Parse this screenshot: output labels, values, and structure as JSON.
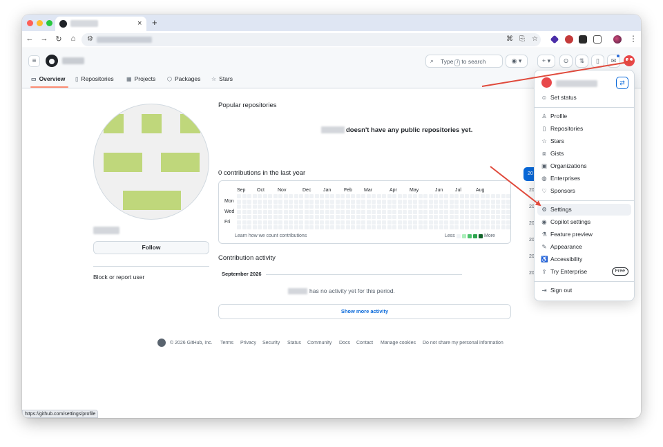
{
  "browser": {
    "new_tab": "+",
    "tab_close": "×",
    "status_url": "https://github.com/settings/profile"
  },
  "header": {
    "search_prefix": "Type",
    "search_slash": "/",
    "search_suffix": "to search",
    "plus_label": "+ ▾"
  },
  "nav": {
    "items": [
      {
        "label": "Overview",
        "icon": "book-icon"
      },
      {
        "label": "Repositories",
        "icon": "repo-icon"
      },
      {
        "label": "Projects",
        "icon": "table-icon"
      },
      {
        "label": "Packages",
        "icon": "package-icon"
      },
      {
        "label": "Stars",
        "icon": "star-icon"
      }
    ]
  },
  "profile": {
    "follow_label": "Follow",
    "block_label": "Block or report user"
  },
  "main": {
    "popular_title": "Popular repositories",
    "no_repos": "doesn't have any public repositories yet.",
    "contrib_title": "0 contributions in the last year",
    "months": [
      "Sep",
      "Oct",
      "Nov",
      "Dec",
      "Jan",
      "Feb",
      "Mar",
      "Apr",
      "May",
      "Jun",
      "Jul",
      "Aug"
    ],
    "days": [
      "Mon",
      "Wed",
      "Fri"
    ],
    "learn_link": "Learn how we count contributions",
    "less": "Less",
    "more": "More",
    "activity_title": "Contribution activity",
    "month_header": "September 2026",
    "no_activity": "has no activity yet for this period.",
    "show_more": "Show more activity",
    "legend_colors": [
      "#eff2f5",
      "#aceebb",
      "#4ac26b",
      "#2da44e",
      "#116329"
    ]
  },
  "year_tabs": {
    "active": "20",
    "others": [
      "20",
      "20",
      "20",
      "20",
      "20",
      "20"
    ]
  },
  "footer": {
    "copyright": "© 2026 GitHub, Inc.",
    "links": [
      "Terms",
      "Privacy",
      "Security",
      "Status",
      "Community",
      "Docs",
      "Contact",
      "Manage cookies",
      "Do not share my personal information"
    ]
  },
  "menu": {
    "switch_icon": "⇄",
    "items": [
      {
        "label": "Set status",
        "icon": "smiley-icon"
      },
      {
        "label": "Profile",
        "icon": "person-icon"
      },
      {
        "label": "Repositories",
        "icon": "repo-icon"
      },
      {
        "label": "Stars",
        "icon": "star-icon"
      },
      {
        "label": "Gists",
        "icon": "code-square-icon"
      },
      {
        "label": "Organizations",
        "icon": "organization-icon"
      },
      {
        "label": "Enterprises",
        "icon": "globe-icon"
      },
      {
        "label": "Sponsors",
        "icon": "heart-icon"
      },
      {
        "label": "Settings",
        "icon": "gear-icon"
      },
      {
        "label": "Copilot settings",
        "icon": "copilot-icon"
      },
      {
        "label": "Feature preview",
        "icon": "beaker-icon"
      },
      {
        "label": "Appearance",
        "icon": "paintbrush-icon"
      },
      {
        "label": "Accessibility",
        "icon": "accessibility-icon"
      },
      {
        "label": "Try Enterprise",
        "icon": "upload-icon",
        "badge": "Free"
      },
      {
        "label": "Sign out",
        "icon": "sign-out-icon"
      }
    ]
  },
  "colors": {
    "accent": "#0969da",
    "annotation_arrow": "#e04a3c",
    "avatar_block": "#bfd77b"
  }
}
